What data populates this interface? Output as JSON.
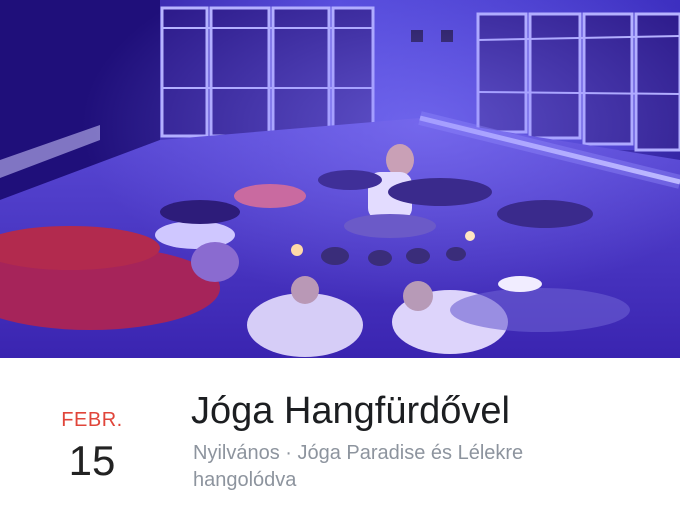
{
  "cover": {
    "alt": "cover-photo"
  },
  "event": {
    "month": "FEBR.",
    "day": "15",
    "title": "Jóga Hangfürdővel",
    "meta": "Nyilvános · Jóga Paradise és Lélekre hangolódva"
  },
  "colors": {
    "month_accent": "#e0453a",
    "title_text": "#1c1e21",
    "meta_text": "#8d949e"
  }
}
